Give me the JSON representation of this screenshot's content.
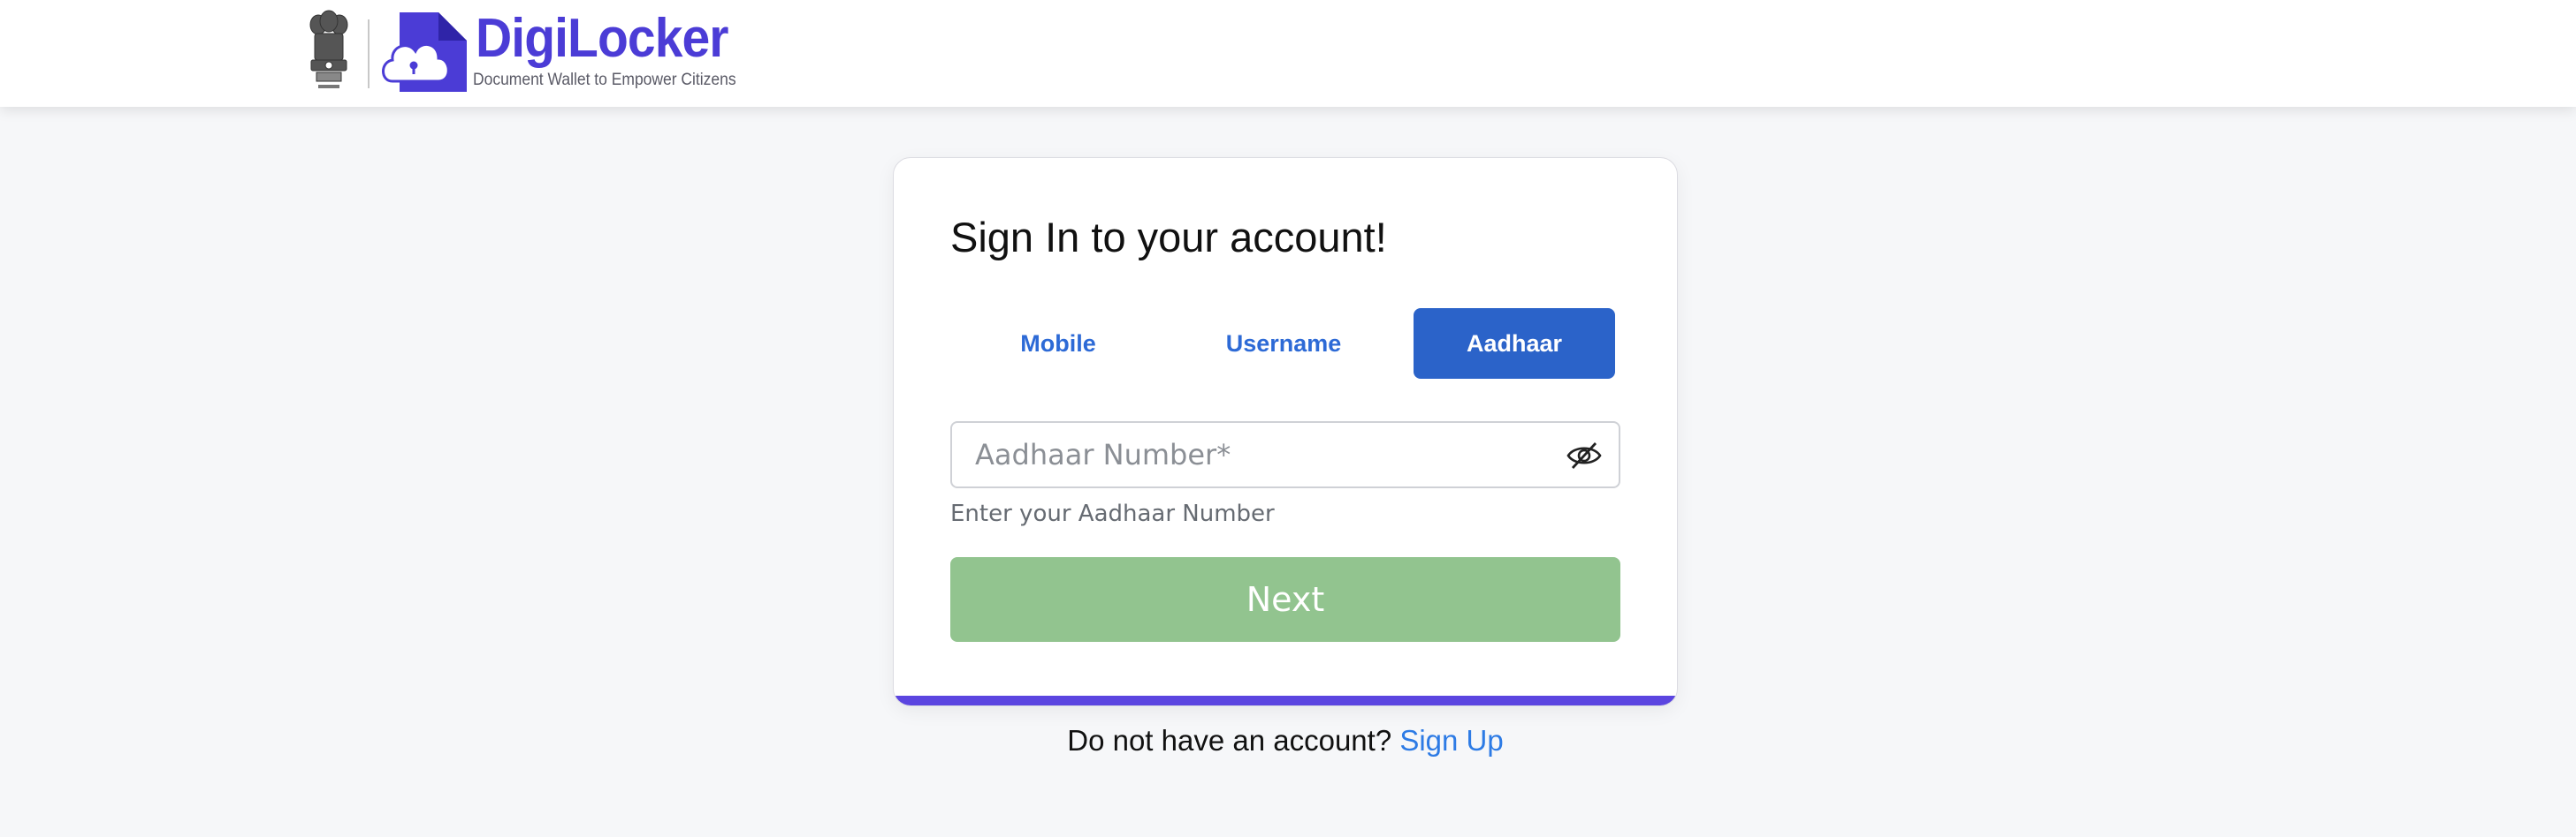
{
  "header": {
    "brand_name": "DigiLocker",
    "tagline": "Document Wallet to Empower Citizens",
    "colors": {
      "brand": "#4b3cd6"
    },
    "emblem_icon": "national-emblem-icon",
    "logo_icon": "digilocker-cloud-lock-icon"
  },
  "signin": {
    "title": "Sign In to your account!",
    "tabs": [
      {
        "label": "Mobile",
        "selected": false
      },
      {
        "label": "Username",
        "selected": false
      },
      {
        "label": "Aadhaar",
        "selected": true
      }
    ],
    "aadhaar_input": {
      "placeholder": "Aadhaar Number*",
      "value": "",
      "toggle_icon": "eye-slash-icon"
    },
    "helper_text": "Enter your Aadhaar Number",
    "next_label": "Next",
    "colors": {
      "tab_active": "#2b63c9",
      "next_button": "#92c48f",
      "card_accent": "#5b45e0"
    }
  },
  "footer": {
    "prompt": "Do not have an account?",
    "signup_label": "Sign Up"
  }
}
